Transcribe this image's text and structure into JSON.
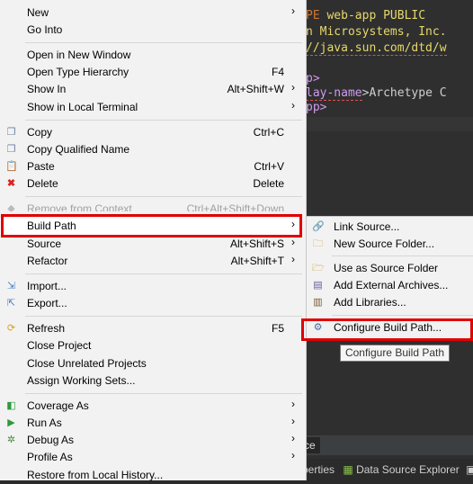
{
  "editor": {
    "line1_a": "PE",
    "line1_b": " web-app PUBLIC",
    "line2": "n Microsystems, Inc.",
    "line3": "//java.sun.com/dtd/w",
    "line4": "p>",
    "line5_a": "lay-name",
    "line5_b": ">Archetype C",
    "line6": "pp>",
    "bottom_tab": "ce",
    "bottom_bar": "perties",
    "bottom_bar_ds": "Data Source Explorer"
  },
  "menu": {
    "new": "New",
    "go_into": "Go Into",
    "open_new_window": "Open in New Window",
    "open_type_hierarchy": "Open Type Hierarchy",
    "open_type_hierarchy_acc": "F4",
    "show_in": "Show In",
    "show_in_acc": "Alt+Shift+W",
    "show_local_terminal": "Show in Local Terminal",
    "copy": "Copy",
    "copy_acc": "Ctrl+C",
    "copy_qualified": "Copy Qualified Name",
    "paste": "Paste",
    "paste_acc": "Ctrl+V",
    "delete": "Delete",
    "delete_acc": "Delete",
    "remove_context": "Remove from Context",
    "remove_context_acc": "Ctrl+Alt+Shift+Down",
    "build_path": "Build Path",
    "source": "Source",
    "source_acc": "Alt+Shift+S",
    "refactor": "Refactor",
    "refactor_acc": "Alt+Shift+T",
    "import": "Import...",
    "export": "Export...",
    "refresh": "Refresh",
    "refresh_acc": "F5",
    "close_project": "Close Project",
    "close_unrelated": "Close Unrelated Projects",
    "assign_working_sets": "Assign Working Sets...",
    "coverage_as": "Coverage As",
    "run_as": "Run As",
    "debug_as": "Debug As",
    "profile_as": "Profile As",
    "restore_history": "Restore from Local History..."
  },
  "submenu": {
    "link_source": "Link Source...",
    "new_source_folder": "New Source Folder...",
    "use_as_source_folder": "Use as Source Folder",
    "add_external_archives": "Add External Archives...",
    "add_libraries": "Add Libraries...",
    "configure_build_path": "Configure Build Path..."
  },
  "tooltip": "Configure Build Path",
  "colors": {
    "highlight_box": "#e00000",
    "menu_bg": "#f2f2f2",
    "editor_bg": "#2f2f2f"
  }
}
